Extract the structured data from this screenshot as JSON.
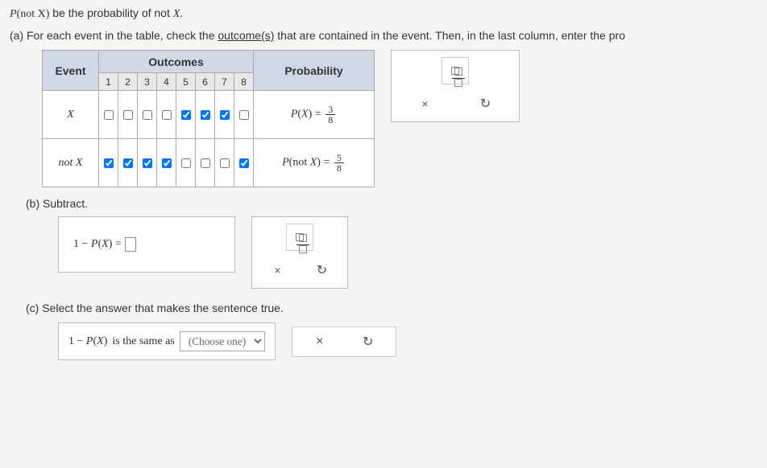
{
  "intro_prefix": "P",
  "intro_arg": "not X",
  "intro_suffix": " be the probability of not ",
  "intro_var": "X",
  "intro_period": ".",
  "partA": {
    "label": "(a)  For each event in the table, check the ",
    "link": "outcome(s)",
    "label2": " that are contained in the event. Then, in the last column, enter the pro",
    "headers": {
      "event": "Event",
      "outcomes": "Outcomes",
      "probability": "Probability"
    },
    "cols": [
      "1",
      "2",
      "3",
      "4",
      "5",
      "6",
      "7",
      "8"
    ],
    "rows": [
      {
        "label": "X",
        "checked": [
          false,
          false,
          false,
          false,
          true,
          true,
          true,
          false
        ],
        "prob_lhs": "P(X)",
        "eq": "=",
        "num": "3",
        "den": "8"
      },
      {
        "label": "not X",
        "checked": [
          true,
          true,
          true,
          true,
          false,
          false,
          false,
          true
        ],
        "prob_lhs": "P(not X)",
        "eq": "=",
        "num": "5",
        "den": "8"
      }
    ]
  },
  "partB": {
    "label": "(b)  Subtract.",
    "eq_lhs": "1 − P(X) = "
  },
  "partC": {
    "label": "(c)  Select the answer that makes the sentence true.",
    "sentence_lhs": "1 − P(X)",
    "sentence_mid": " is the same as ",
    "choose_placeholder": "(Choose one)"
  },
  "icons": {
    "times": "×",
    "reset": "↻"
  }
}
